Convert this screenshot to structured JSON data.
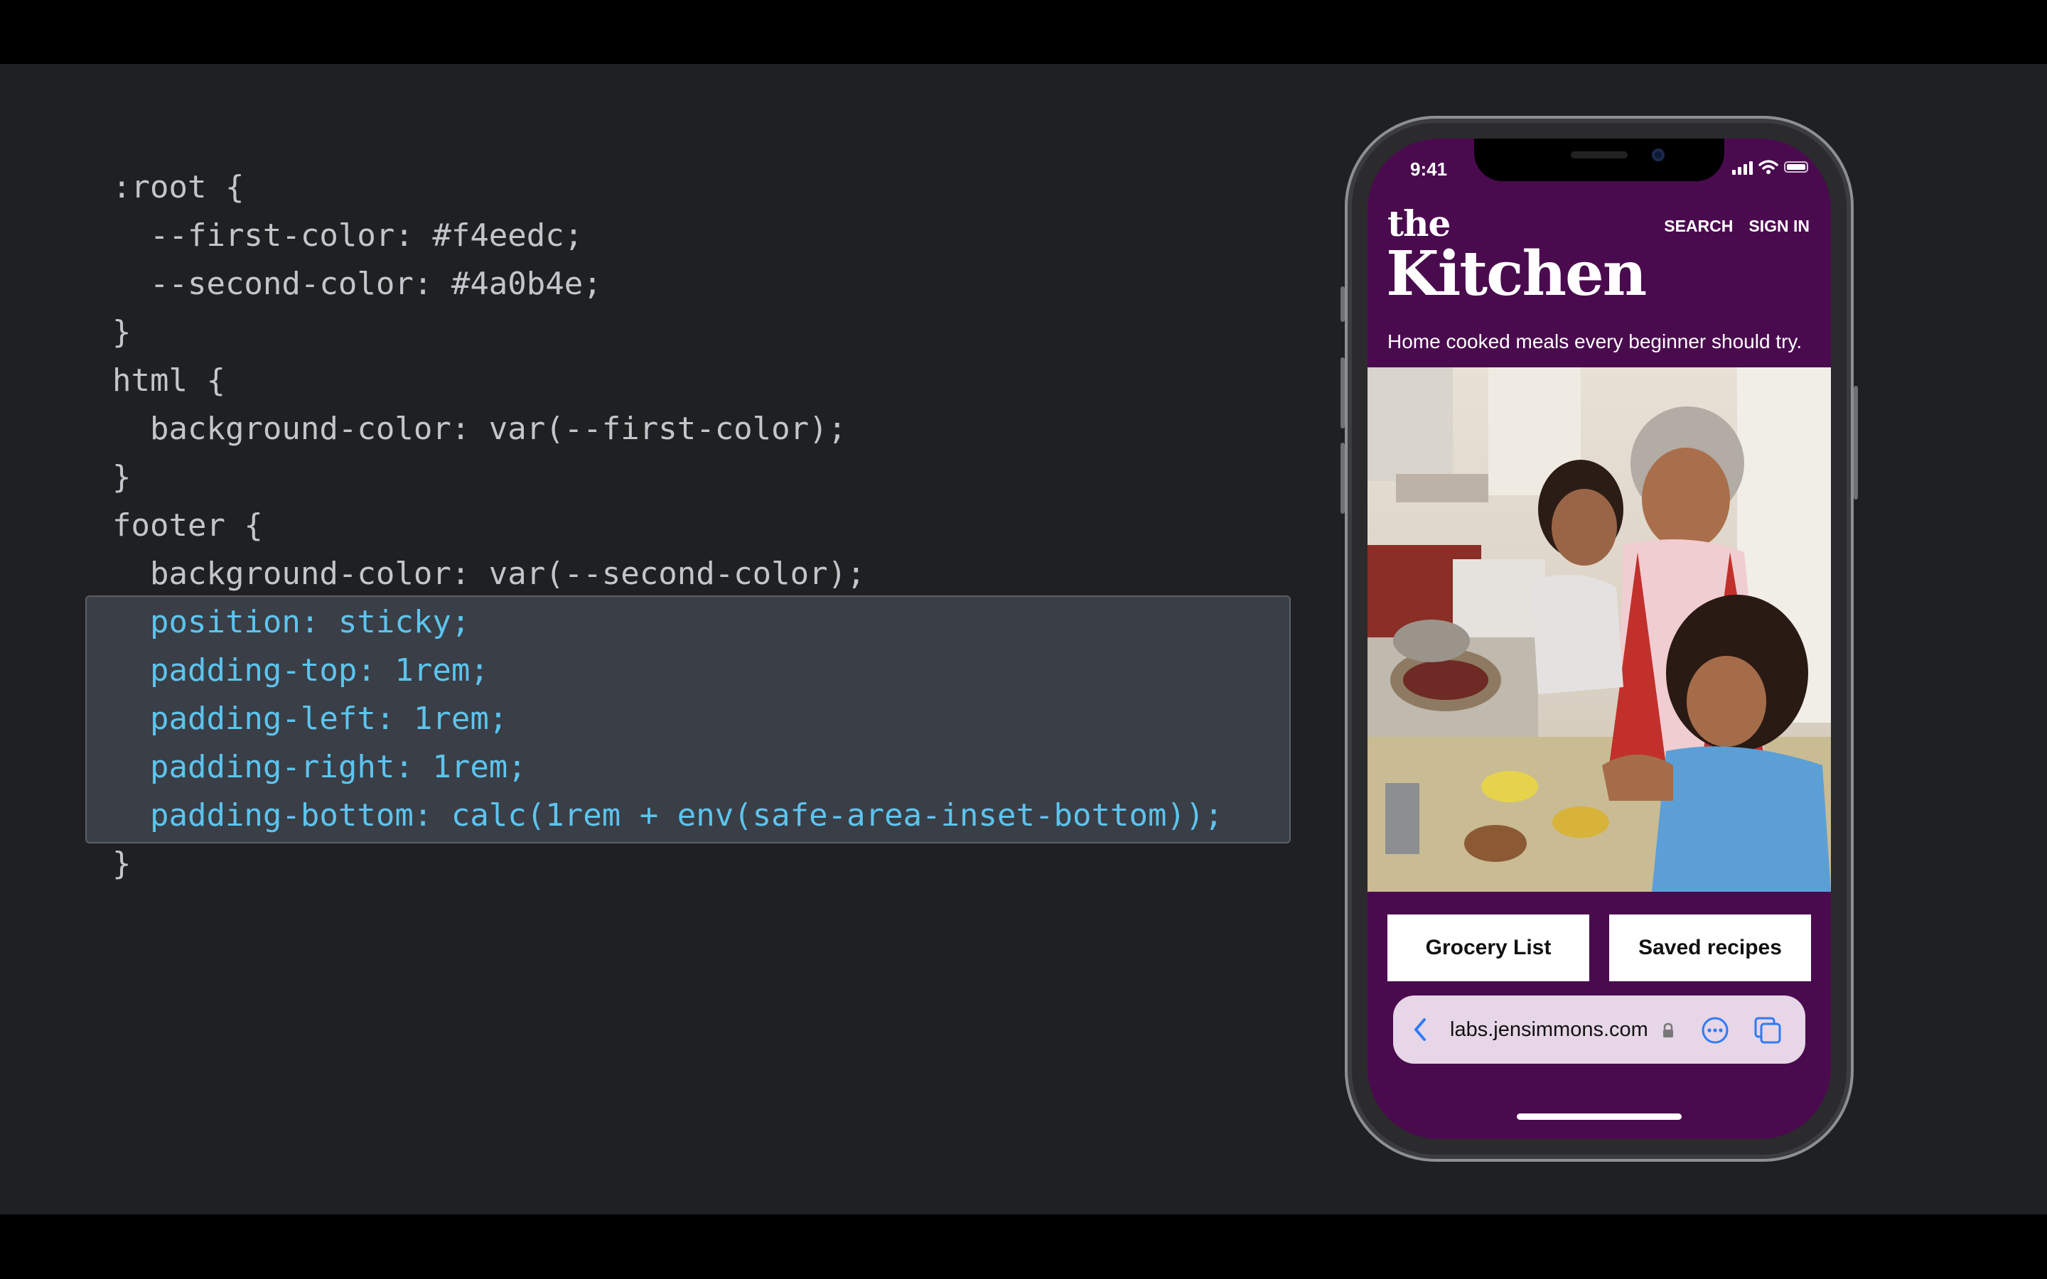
{
  "code": {
    "lines": [
      {
        "text": ":root {",
        "hl": false
      },
      {
        "text": "  --first-color: #f4eedc;",
        "hl": false
      },
      {
        "text": "  --second-color: #4a0b4e;",
        "hl": false
      },
      {
        "text": "}",
        "hl": false
      },
      {
        "text": "html {",
        "hl": false
      },
      {
        "text": "  background-color: var(--first-color);",
        "hl": false
      },
      {
        "text": "}",
        "hl": false
      },
      {
        "text": "footer {",
        "hl": false
      },
      {
        "text": "  background-color: var(--second-color);",
        "hl": false
      },
      {
        "text": "  position: sticky;",
        "hl": true
      },
      {
        "text": "  padding-top: 1rem;",
        "hl": true
      },
      {
        "text": "  padding-left: 1rem;",
        "hl": true
      },
      {
        "text": "  padding-right: 1rem;",
        "hl": true
      },
      {
        "text": "  padding-bottom: calc(1rem + env(safe-area-inset-bottom));",
        "hl": true
      },
      {
        "text": "}",
        "hl": false
      }
    ]
  },
  "phone": {
    "status": {
      "time": "9:41",
      "icons": [
        "signal-icon",
        "wifi-icon",
        "battery-icon"
      ]
    },
    "site": {
      "logo_the": "the",
      "logo_main": "Kitchen",
      "nav": {
        "search": "SEARCH",
        "sign_in": "SIGN IN"
      },
      "tagline": "Home cooked meals every beginner should try."
    },
    "actions": {
      "grocery": "Grocery List",
      "saved": "Saved recipes"
    },
    "browser": {
      "url": "labs.jensimmons.com",
      "icons": [
        "back-chevron-icon",
        "lock-icon",
        "more-icon",
        "tabs-icon"
      ]
    }
  },
  "colors": {
    "first_color": "#f4eedc",
    "second_color": "#4a0b4e",
    "code_highlight": "#5cc4ee",
    "code_text": "#c2c6cb"
  }
}
